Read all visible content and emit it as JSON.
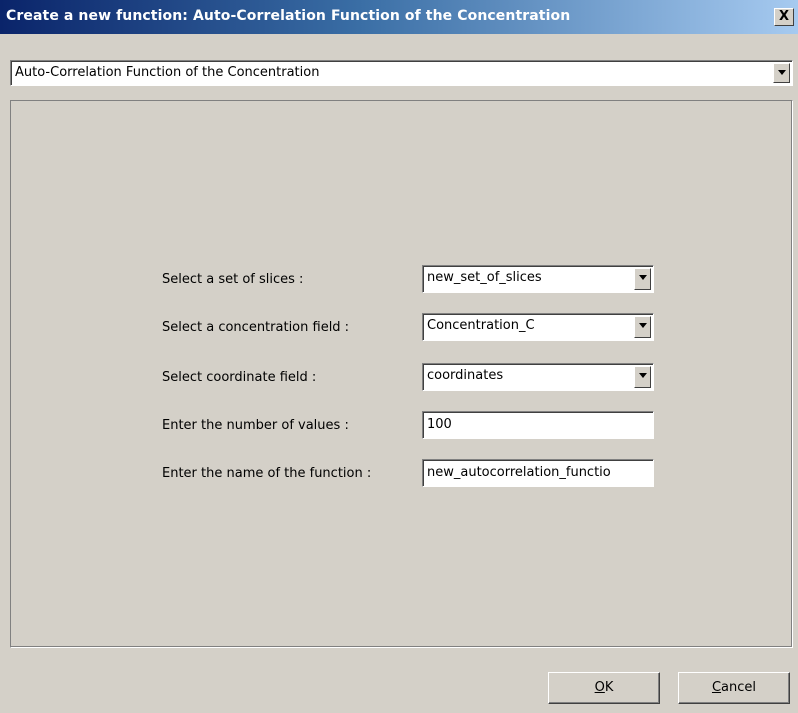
{
  "window": {
    "title": "Create a new function: Auto-Correlation Function of the Concentration",
    "close_glyph": "X"
  },
  "function_type": {
    "selected": "Auto-Correlation Function of the Concentration"
  },
  "form": {
    "slices": {
      "label": "Select a set of slices :",
      "value": "new_set_of_slices"
    },
    "concentration": {
      "label": "Select a concentration field :",
      "value": "Concentration_C"
    },
    "coordinates": {
      "label": "Select coordinate field :",
      "value": "coordinates"
    },
    "num_values": {
      "label": "Enter the number of values :",
      "value": "100"
    },
    "function_name": {
      "label": "Enter the name of the function :",
      "value": "new_autocorrelation_functio"
    }
  },
  "buttons": {
    "ok_mnemonic": "O",
    "ok_rest": "K",
    "cancel_mnemonic": "C",
    "cancel_rest": "ancel"
  },
  "icons": {
    "dropdown": "chevron-down-icon",
    "close": "close-icon"
  },
  "colors": {
    "titlebar_start": "#0a246a",
    "titlebar_end": "#a6caf0",
    "dialog_face": "#d4d0c8"
  }
}
